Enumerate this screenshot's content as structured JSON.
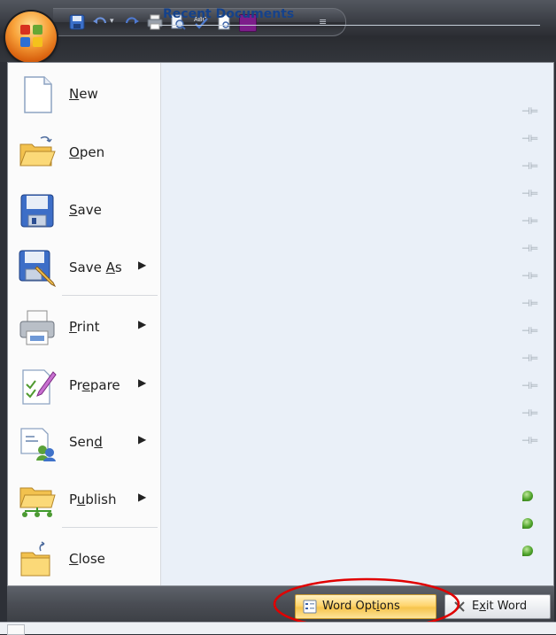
{
  "quick_access_toolbar": {
    "icons": [
      "save-icon",
      "undo-icon",
      "dropdown-icon",
      "redo-icon",
      "print-icon",
      "print-preview-icon",
      "spelling-icon",
      "preview-icon",
      "color-square-icon",
      "customize-qat-icon"
    ]
  },
  "menu": {
    "commands": [
      {
        "id": "new",
        "pre": "",
        "key": "N",
        "post": "ew",
        "has_submenu": false
      },
      {
        "id": "open",
        "pre": "",
        "key": "O",
        "post": "pen",
        "has_submenu": false
      },
      {
        "id": "save",
        "pre": "",
        "key": "S",
        "post": "ave",
        "has_submenu": false
      },
      {
        "id": "save-as",
        "pre": "Save ",
        "key": "A",
        "post": "s",
        "has_submenu": true
      },
      {
        "id": "print",
        "pre": "",
        "key": "P",
        "post": "rint",
        "has_submenu": true
      },
      {
        "id": "prepare",
        "pre": "Pr",
        "key": "e",
        "post": "pare",
        "has_submenu": true
      },
      {
        "id": "send",
        "pre": "Sen",
        "key": "d",
        "post": "",
        "has_submenu": true
      },
      {
        "id": "publish",
        "pre": "P",
        "key": "u",
        "post": "blish",
        "has_submenu": true
      },
      {
        "id": "close",
        "pre": "",
        "key": "C",
        "post": "lose",
        "has_submenu": false
      }
    ],
    "submenu_arrow": "▶"
  },
  "recent": {
    "title": "Recent Documents",
    "pin_glyph": "⊣⊨",
    "unpinned_count": 13,
    "pinned_count": 3
  },
  "footer": {
    "options_pre": "Word Opt",
    "options_key": "i",
    "options_post": "ons",
    "exit_pre": "E",
    "exit_key": "x",
    "exit_post": "it Word"
  },
  "colors": {
    "accent_header": "#15428b",
    "right_pane_bg": "#eaf0f8",
    "options_highlight": "#ffd56e",
    "annotation_red": "#e00000"
  }
}
